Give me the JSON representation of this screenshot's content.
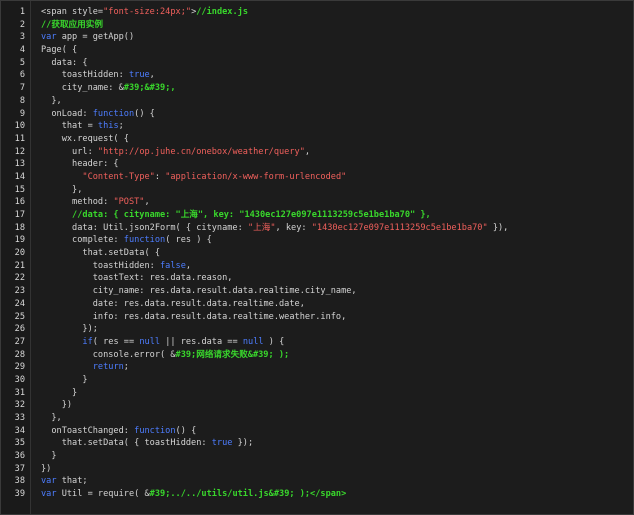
{
  "colors": {
    "background": "#1c1c1c",
    "gutter_background": "#1a1a1a",
    "line_number": "#d8d8d8",
    "plain": "#d4d4d4",
    "keyword": "#4d7dff",
    "string": "#f0605c",
    "comment": "#39d72c"
  },
  "code": {
    "lines": [
      [
        {
          "t": "<span style=",
          "k": "p"
        },
        {
          "t": "\"font-size:24px;\"",
          "k": "s"
        },
        {
          "t": ">",
          "k": "p"
        },
        {
          "t": "//index.js",
          "k": "c"
        }
      ],
      [
        {
          "t": "//获取应用实例",
          "k": "c"
        }
      ],
      [
        {
          "t": "var",
          "k": "k"
        },
        {
          "t": " app = getApp()",
          "k": "p"
        }
      ],
      [
        {
          "t": "Page( {",
          "k": "p"
        }
      ],
      [
        {
          "t": "  data: {",
          "k": "p"
        }
      ],
      [
        {
          "t": "    toastHidden: ",
          "k": "p"
        },
        {
          "t": "true",
          "k": "b"
        },
        {
          "t": ",",
          "k": "p"
        }
      ],
      [
        {
          "t": "    city_name: &",
          "k": "p"
        },
        {
          "t": "#39;&#39;,",
          "k": "c"
        }
      ],
      [
        {
          "t": "  },",
          "k": "p"
        }
      ],
      [
        {
          "t": "  onLoad: ",
          "k": "p"
        },
        {
          "t": "function",
          "k": "k"
        },
        {
          "t": "() {",
          "k": "p"
        }
      ],
      [
        {
          "t": "    that = ",
          "k": "p"
        },
        {
          "t": "this",
          "k": "k"
        },
        {
          "t": ";",
          "k": "p"
        }
      ],
      [
        {
          "t": "    wx.request( {",
          "k": "p"
        }
      ],
      [
        {
          "t": "      url: ",
          "k": "p"
        },
        {
          "t": "\"http://op.juhe.cn/onebox/weather/query\"",
          "k": "s"
        },
        {
          "t": ",",
          "k": "p"
        }
      ],
      [
        {
          "t": "      header: {",
          "k": "p"
        }
      ],
      [
        {
          "t": "        ",
          "k": "p"
        },
        {
          "t": "\"Content-Type\"",
          "k": "s"
        },
        {
          "t": ": ",
          "k": "p"
        },
        {
          "t": "\"application/x-www-form-urlencoded\"",
          "k": "s"
        }
      ],
      [
        {
          "t": "      },",
          "k": "p"
        }
      ],
      [
        {
          "t": "      method: ",
          "k": "p"
        },
        {
          "t": "\"POST\"",
          "k": "s"
        },
        {
          "t": ",",
          "k": "p"
        }
      ],
      [
        {
          "t": "      //data: { cityname: \"上海\", key: \"1430ec127e097e1113259c5e1be1ba70\" },",
          "k": "c"
        }
      ],
      [
        {
          "t": "      data: Util.json2Form( { cityname: ",
          "k": "p"
        },
        {
          "t": "\"上海\"",
          "k": "s"
        },
        {
          "t": ", key: ",
          "k": "p"
        },
        {
          "t": "\"1430ec127e097e1113259c5e1be1ba70\"",
          "k": "s"
        },
        {
          "t": " }),",
          "k": "p"
        }
      ],
      [
        {
          "t": "      complete: ",
          "k": "p"
        },
        {
          "t": "function",
          "k": "k"
        },
        {
          "t": "( res ) {",
          "k": "p"
        }
      ],
      [
        {
          "t": "        that.setData( {",
          "k": "p"
        }
      ],
      [
        {
          "t": "          toastHidden: ",
          "k": "p"
        },
        {
          "t": "false",
          "k": "b"
        },
        {
          "t": ",",
          "k": "p"
        }
      ],
      [
        {
          "t": "          toastText: res.data.reason,",
          "k": "p"
        }
      ],
      [
        {
          "t": "          city_name: res.data.result.data.realtime.city_name,",
          "k": "p"
        }
      ],
      [
        {
          "t": "          date: res.data.result.data.realtime.date,",
          "k": "p"
        }
      ],
      [
        {
          "t": "          info: res.data.result.data.realtime.weather.info,",
          "k": "p"
        }
      ],
      [
        {
          "t": "        });",
          "k": "p"
        }
      ],
      [
        {
          "t": "        ",
          "k": "p"
        },
        {
          "t": "if",
          "k": "k"
        },
        {
          "t": "( res == ",
          "k": "p"
        },
        {
          "t": "null",
          "k": "b"
        },
        {
          "t": " || res.data == ",
          "k": "p"
        },
        {
          "t": "null",
          "k": "b"
        },
        {
          "t": " ) {",
          "k": "p"
        }
      ],
      [
        {
          "t": "          console.error( &",
          "k": "p"
        },
        {
          "t": "#39;网络请求失败&#39; );",
          "k": "c"
        }
      ],
      [
        {
          "t": "          ",
          "k": "p"
        },
        {
          "t": "return",
          "k": "k"
        },
        {
          "t": ";",
          "k": "p"
        }
      ],
      [
        {
          "t": "        }",
          "k": "p"
        }
      ],
      [
        {
          "t": "      }",
          "k": "p"
        }
      ],
      [
        {
          "t": "    })",
          "k": "p"
        }
      ],
      [
        {
          "t": "  },",
          "k": "p"
        }
      ],
      [
        {
          "t": "  onToastChanged: ",
          "k": "p"
        },
        {
          "t": "function",
          "k": "k"
        },
        {
          "t": "() {",
          "k": "p"
        }
      ],
      [
        {
          "t": "    that.setData( { toastHidden: ",
          "k": "p"
        },
        {
          "t": "true",
          "k": "b"
        },
        {
          "t": " });",
          "k": "p"
        }
      ],
      [
        {
          "t": "  }",
          "k": "p"
        }
      ],
      [
        {
          "t": "})",
          "k": "p"
        }
      ],
      [
        {
          "t": "var",
          "k": "k"
        },
        {
          "t": " that;",
          "k": "p"
        }
      ],
      [
        {
          "t": "var",
          "k": "k"
        },
        {
          "t": " Util = require( &",
          "k": "p"
        },
        {
          "t": "#39;../../utils/util.js&#39; );</span>",
          "k": "c"
        }
      ]
    ]
  }
}
